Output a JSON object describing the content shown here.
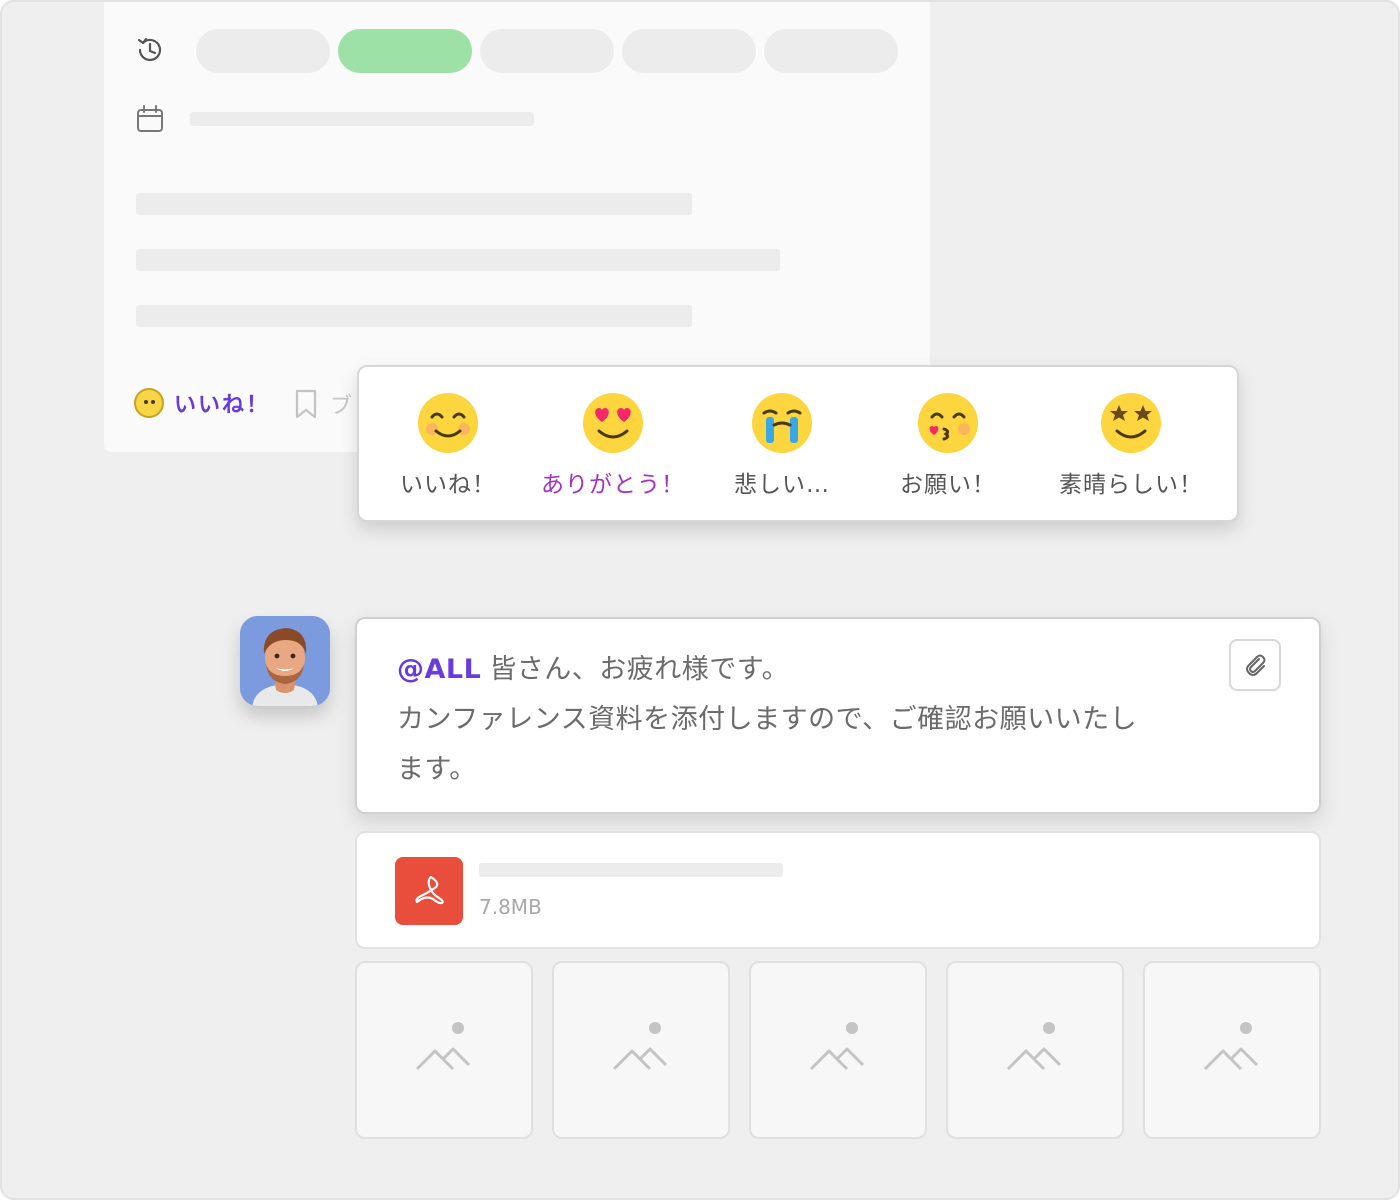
{
  "top_card": {
    "like_label": "いいね！",
    "truncated_label": "ブ"
  },
  "reactions": [
    {
      "label": "いいね！",
      "icon": "smile-icon"
    },
    {
      "label": "ありがとう！",
      "icon": "heart-eyes-icon",
      "selected": true
    },
    {
      "label": "悲しい…",
      "icon": "crying-icon"
    },
    {
      "label": "お願い！",
      "icon": "kiss-icon"
    },
    {
      "label": "素晴らしい！",
      "icon": "star-eyes-icon"
    }
  ],
  "message": {
    "mention": "@ALL",
    "line1": "皆さん、お疲れ様です。",
    "line2": "カンファレンス資料を添付しますので、ご確認お願いいたし",
    "line3": "ます。"
  },
  "attachment": {
    "size": "7.8MB"
  },
  "colors": {
    "accent": "#6a3bdc",
    "selected_reaction": "#a232c9",
    "active_pill": "#9de1a7",
    "pdf": "#e94d3c"
  }
}
